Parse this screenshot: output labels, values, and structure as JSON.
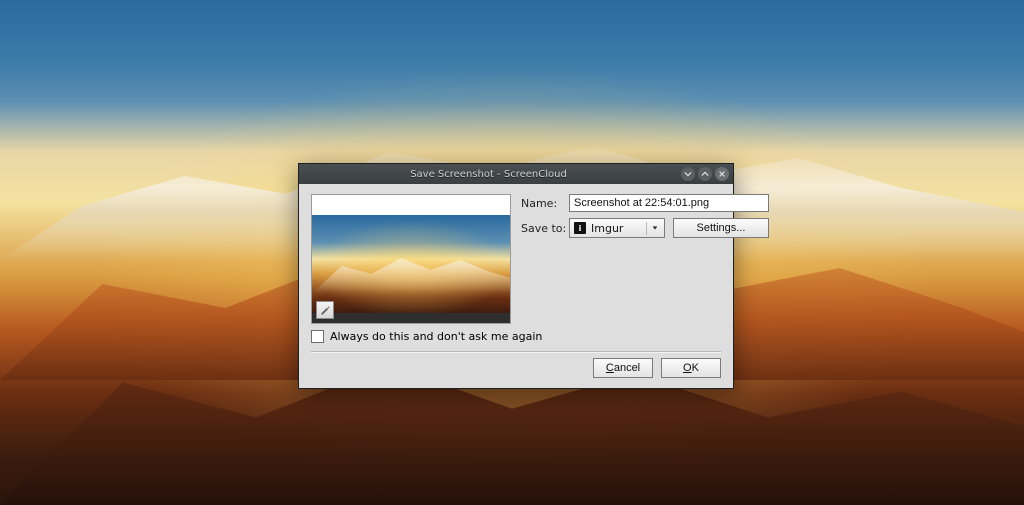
{
  "window": {
    "title": "Save Screenshot - ScreenCloud",
    "controls": {
      "minimize": "minimize",
      "maximize": "maximize",
      "close": "close"
    }
  },
  "form": {
    "name_label": "Name:",
    "name_value": "Screenshot at 22:54:01.png",
    "saveto_label": "Save to:",
    "saveto_selected": "Imgur",
    "saveto_icon": "i",
    "settings_label": "Settings...",
    "checkbox_checked": false,
    "checkbox_label": "Always do this and don't ask me again"
  },
  "footer": {
    "cancel": {
      "mnemonic": "C",
      "rest": "ancel"
    },
    "ok": {
      "mnemonic": "O",
      "rest": "K"
    }
  },
  "preview": {
    "edit_icon": "pencil"
  }
}
